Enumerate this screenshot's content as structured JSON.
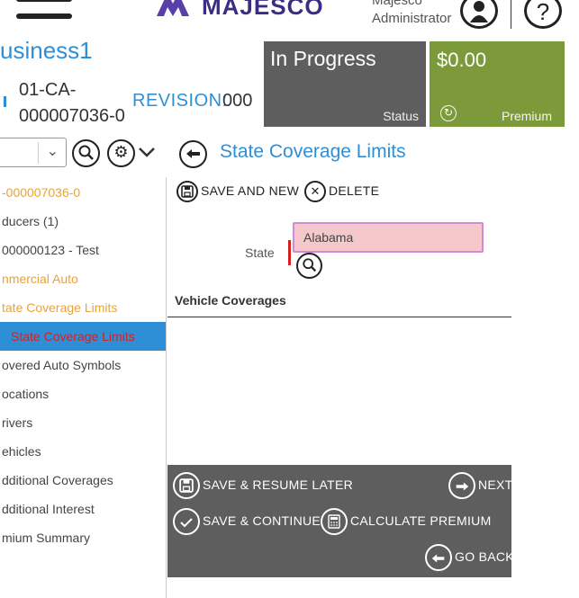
{
  "header": {
    "brand": "MAJESCO",
    "user_name": "Majesco",
    "user_role": "Administrator",
    "user_icon": "user-icon",
    "help_icon": "help-icon",
    "help_glyph": "?"
  },
  "policy": {
    "name": "usiness1",
    "number": "01-CA-000007036-0",
    "revision_label": "REVISION:",
    "revision_value": "000"
  },
  "tiles": {
    "status_value": "In Progress",
    "status_label": "Status",
    "premium_value": "$0.00",
    "premium_label": "Premium"
  },
  "toolbar": {
    "section_title": "State Coverage Limits"
  },
  "sidebar": {
    "items": [
      {
        "label": "-000007036-0"
      },
      {
        "label": "ducers (1)"
      },
      {
        "label": "000000123 - Test"
      },
      {
        "label": "nmercial Auto"
      },
      {
        "label": "tate Coverage Limits"
      },
      {
        "label": "State Coverage Limits"
      },
      {
        "label": "overed Auto Symbols"
      },
      {
        "label": "ocations"
      },
      {
        "label": "rivers"
      },
      {
        "label": "ehicles"
      },
      {
        "label": "dditional Coverages"
      },
      {
        "label": "dditional Interest"
      },
      {
        "label": "mium Summary"
      }
    ]
  },
  "form": {
    "save_and_new": "SAVE AND NEW",
    "delete": "DELETE",
    "state_label": "State",
    "state_value": "Alabama",
    "vehicle_coverages_title": "Vehicle Coverages"
  },
  "footer": {
    "save_resume": "SAVE & RESUME LATER",
    "next": "NEXT",
    "save_continue": "SAVE & CONTINUE",
    "calculate_premium": "CALCULATE PREMIUM",
    "go_back": "GO BACK"
  },
  "colors": {
    "accent_blue": "#2f8fd6",
    "status_gray": "#5e5e5e",
    "premium_green": "#7d9a3b",
    "orange": "#e8a33a",
    "error_red": "#d62020",
    "brand_purple": "#3b2d82"
  }
}
